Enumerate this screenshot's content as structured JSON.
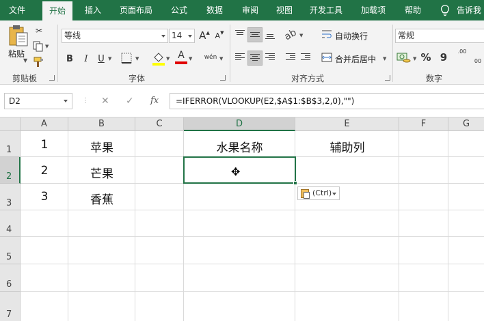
{
  "menu": {
    "tabs": [
      "文件",
      "开始",
      "插入",
      "页面布局",
      "公式",
      "数据",
      "审阅",
      "视图",
      "开发工具",
      "加载项",
      "帮助"
    ],
    "active_tab": "开始",
    "tell_me": "告诉我"
  },
  "ribbon": {
    "clipboard": {
      "paste_label": "粘贴",
      "group_label": "剪贴板"
    },
    "font": {
      "name": "等线",
      "size": "14",
      "bold": "B",
      "italic": "I",
      "underline": "U",
      "phonetic": "wén",
      "grow_font": "A",
      "shrink_font": "A",
      "font_color_glyph": "A",
      "group_label": "字体"
    },
    "alignment": {
      "wrap_text": "自动换行",
      "merge_center": "合并后居中",
      "group_label": "对齐方式"
    },
    "number": {
      "format": "常规",
      "percent": "%",
      "comma": "9",
      "inc_decimal": ".00",
      "dec_decimal": "00",
      "group_label": "数字"
    }
  },
  "formula_bar": {
    "name_box": "D2",
    "formula": "=IFERROR(VLOOKUP(E2,$A$1:$B$3,2,0),\"\")",
    "fx_label": "fx"
  },
  "sheet": {
    "columns": [
      "A",
      "B",
      "C",
      "D",
      "E",
      "F",
      "G"
    ],
    "rows": [
      "1",
      "2",
      "3",
      "4",
      "5",
      "6",
      "7"
    ],
    "selected_cell": "D2",
    "cells": {
      "A1": "1",
      "A2": "2",
      "A3": "3",
      "B1": "苹果",
      "B2": "芒果",
      "B3": "香蕉",
      "D1": "水果名称",
      "E1": "辅助列"
    },
    "paste_options_label": "(Ctrl)"
  },
  "colors": {
    "brand": "#217346",
    "selection": "#217346"
  }
}
